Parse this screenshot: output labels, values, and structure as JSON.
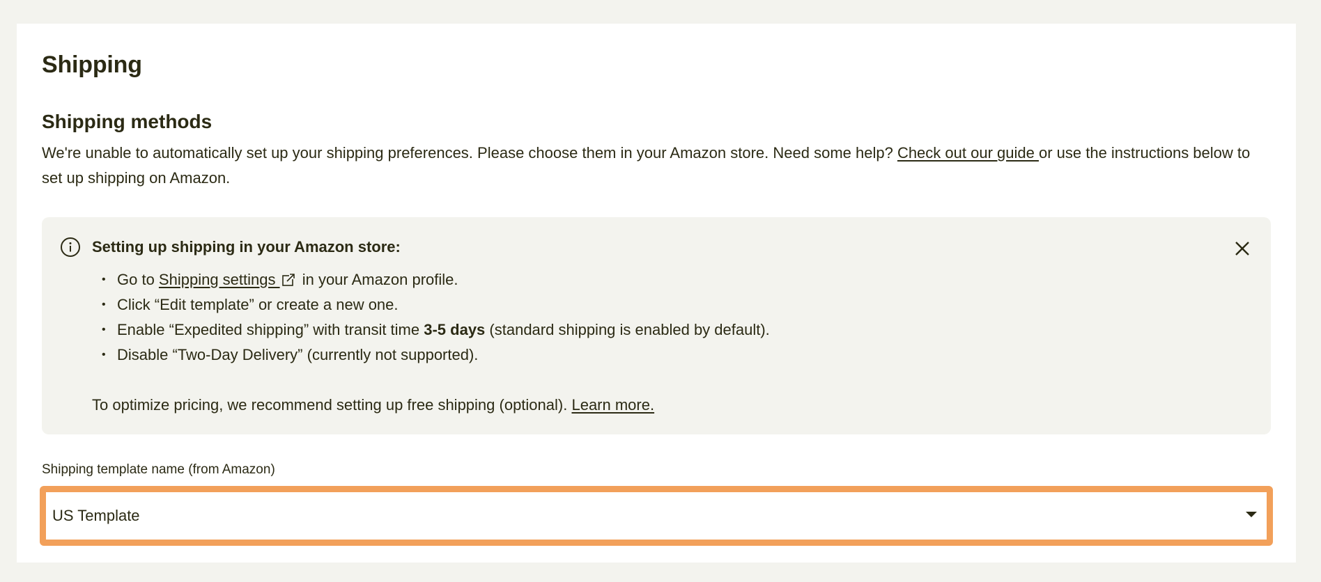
{
  "page": {
    "title": "Shipping"
  },
  "methods": {
    "title": "Shipping methods",
    "desc_before": "We're unable to automatically set up your shipping preferences. Please choose them in your Amazon store. Need some help? ",
    "guide_link": "Check out our guide ",
    "desc_after": "or use the instructions below to set up shipping on Amazon."
  },
  "info": {
    "icon": "info-icon",
    "close_icon": "close-icon",
    "title": "Setting up shipping in your Amazon store:",
    "step1_before": "Go to ",
    "step1_link": "Shipping settings ",
    "step1_icon": "external-link-icon",
    "step1_after": " in your Amazon profile.",
    "step2": "Click “Edit template” or create a new one.",
    "step3_before": "Enable “Expedited shipping” with transit time ",
    "step3_bold": "3-5 days",
    "step3_after": " (standard shipping is enabled by default).",
    "step4": "Disable “Two-Day Delivery” (currently not supported).",
    "tip": "To optimize pricing, we recommend setting up free shipping (optional). ",
    "learn_more": "Learn more."
  },
  "template_field": {
    "label": "Shipping template name (from Amazon)",
    "value": "US Template",
    "caret_icon": "caret-down-icon"
  },
  "colors": {
    "background": "#f3f3ee",
    "text": "#2b2a14",
    "focus_border": "#f2a05a"
  }
}
